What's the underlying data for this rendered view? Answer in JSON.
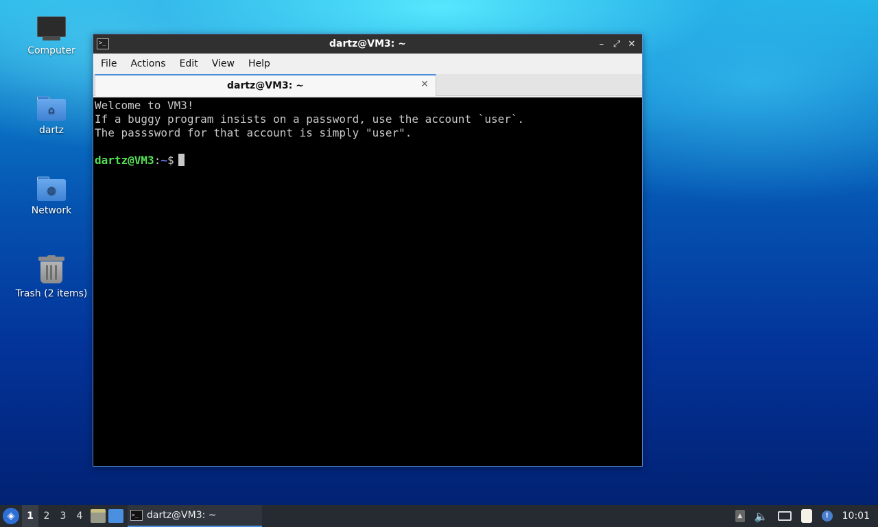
{
  "desktop": {
    "icons": [
      {
        "label": "Computer",
        "icon": "computer-icon"
      },
      {
        "label": "dartz",
        "icon": "home-folder-icon"
      },
      {
        "label": "Network",
        "icon": "network-folder-icon"
      },
      {
        "label": "Trash (2 items)",
        "icon": "trash-icon"
      }
    ]
  },
  "window": {
    "title": "dartz@VM3: ~",
    "menu": [
      "File",
      "Actions",
      "Edit",
      "View",
      "Help"
    ],
    "tab_label": "dartz@VM3: ~",
    "terminal": {
      "lines": [
        "Welcome to VM3!",
        "If a buggy program insists on a password, use the account `user`.",
        "The passsword for that account is simply \"user\"."
      ],
      "prompt_user": "dartz@VM3",
      "prompt_sep": ":",
      "prompt_path": "~",
      "prompt_symbol": "$"
    }
  },
  "taskbar": {
    "workspaces": [
      "1",
      "2",
      "3",
      "4"
    ],
    "active_workspace": "1",
    "task_label": "dartz@VM3: ~",
    "clock": "10:01"
  },
  "colors": {
    "prompt_user": "#55e055",
    "prompt_path": "#6b7cff",
    "accent": "#4a90d9"
  }
}
